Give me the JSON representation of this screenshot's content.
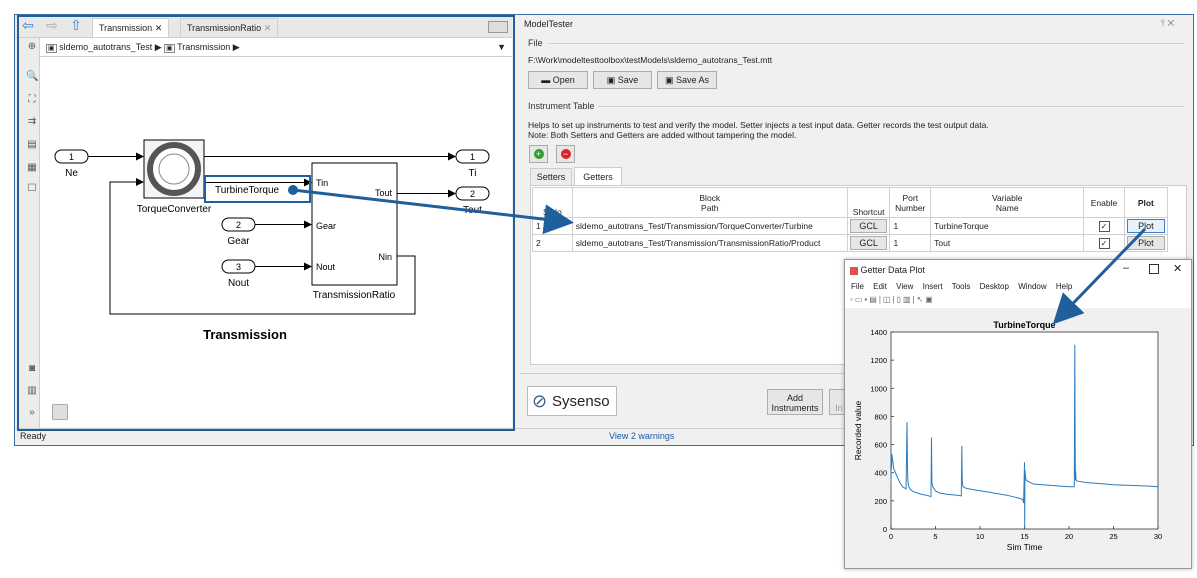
{
  "left": {
    "tabs": [
      "Transmission",
      "TransmissionRatio"
    ],
    "breadcrumb": [
      "sldemo_autotrans_Test",
      "Transmission"
    ],
    "model_title": "Transmission",
    "blocks": {
      "torque_converter": "TorqueConverter",
      "transmission_ratio": "TransmissionRatio",
      "tin": "Tin",
      "tout": "Tout",
      "gear_port": "Gear",
      "nout_port": "Nout",
      "nin": "Nin",
      "highlight": "TurbineTorque"
    },
    "inports": [
      {
        "num": "1",
        "label": "Ne"
      },
      {
        "num": "2",
        "label": "Gear"
      },
      {
        "num": "3",
        "label": "Nout"
      }
    ],
    "outports": [
      {
        "num": "1",
        "label": "Ti"
      },
      {
        "num": "2",
        "label": "Tout"
      }
    ],
    "status": "Ready",
    "warnings": "View 2 warnings"
  },
  "tester": {
    "title": "ModelTester",
    "file_group": "File",
    "file_path": "F:\\Work\\modeltesttoolbox\\testModels\\sldemo_autotrans_Test.mtt",
    "open_label": "Open",
    "save_label": "Save",
    "save_as_label": "Save As",
    "instrument_group": "Instrument Table",
    "desc1": "Helps to set up instruments to test and verify the model. Setter injects a test input data. Getter records the test output data.",
    "desc2": "Note: Both Setters and Getters are added without tampering the model.",
    "tabs": [
      "Setters",
      "Getters"
    ],
    "columns": {
      "sno": "S.No",
      "path1": "Block",
      "path2": "Path",
      "shortcut": "Shortcut",
      "port1": "Port",
      "port2": "Number",
      "var1": "Variable",
      "var2": "Name",
      "enable": "Enable",
      "plot": "Plot"
    },
    "rows": [
      {
        "sno": "1",
        "path": "sldemo_autotrans_Test/Transmission/TorqueConverter/Turbine",
        "shortcut": "GCL",
        "port": "1",
        "var": "TurbineTorque",
        "enabled": true,
        "plot": "Plot"
      },
      {
        "sno": "2",
        "path": "sldemo_autotrans_Test/Transmission/TransmissionRatio/Product",
        "shortcut": "GCL",
        "port": "1",
        "var": "Tout",
        "enabled": true,
        "plot": "Plot"
      }
    ],
    "logo": "Sysenso",
    "add1": "Add",
    "add2": "Instruments",
    "partial": "In"
  },
  "plot_window": {
    "title": "Getter Data Plot",
    "menu": [
      "File",
      "Edit",
      "View",
      "Insert",
      "Tools",
      "Desktop",
      "Window",
      "Help"
    ],
    "min_icon": "minimize-icon",
    "max_icon": "maximize-icon",
    "close_icon": "close-icon"
  },
  "chart_data": {
    "type": "line",
    "title": "TurbineTorque",
    "xlabel": "Sim Time",
    "ylabel": "Recorded value",
    "xlim": [
      0,
      30
    ],
    "ylim": [
      0,
      1400
    ],
    "xticks": [
      "0",
      "5",
      "10",
      "15",
      "20",
      "25",
      "30"
    ],
    "yticks": [
      "0",
      "200",
      "400",
      "600",
      "800",
      "1000",
      "1200",
      "1400"
    ],
    "color": "#2b7bc0",
    "series": [
      {
        "x": [
          0,
          0.02,
          0.05,
          0.1,
          0.2,
          0.3,
          0.5,
          0.7,
          1.0,
          1.3,
          1.7,
          1.8,
          1.85,
          1.9,
          2.0,
          2.2,
          2.5,
          3.0,
          3.5,
          4.0,
          4.5,
          4.55,
          4.6,
          4.7,
          5.0,
          5.5,
          6.5,
          7.5,
          7.9,
          7.95,
          8.0,
          8.1,
          8.4,
          9.0,
          10,
          11,
          12,
          13,
          14,
          14.8,
          14.9,
          15.0,
          15.02,
          15.05,
          15.1,
          15.15,
          15.2,
          15.5,
          16,
          17,
          18,
          19,
          20,
          20.6,
          20.65,
          20.7,
          20.72,
          20.75,
          20.8,
          21,
          22,
          23,
          24,
          25,
          26,
          27,
          28,
          29,
          30
        ],
        "y": [
          320,
          550,
          420,
          530,
          480,
          430,
          400,
          370,
          330,
          300,
          285,
          760,
          440,
          340,
          300,
          280,
          265,
          255,
          245,
          240,
          230,
          650,
          330,
          300,
          270,
          255,
          245,
          240,
          235,
          590,
          340,
          300,
          290,
          282,
          272,
          262,
          250,
          240,
          225,
          210,
          185,
          475,
          10,
          420,
          380,
          360,
          345,
          335,
          320,
          315,
          310,
          305,
          300,
          300,
          1310,
          520,
          350,
          410,
          345,
          340,
          330,
          325,
          320,
          315,
          312,
          310,
          308,
          305,
          300
        ]
      }
    ]
  }
}
